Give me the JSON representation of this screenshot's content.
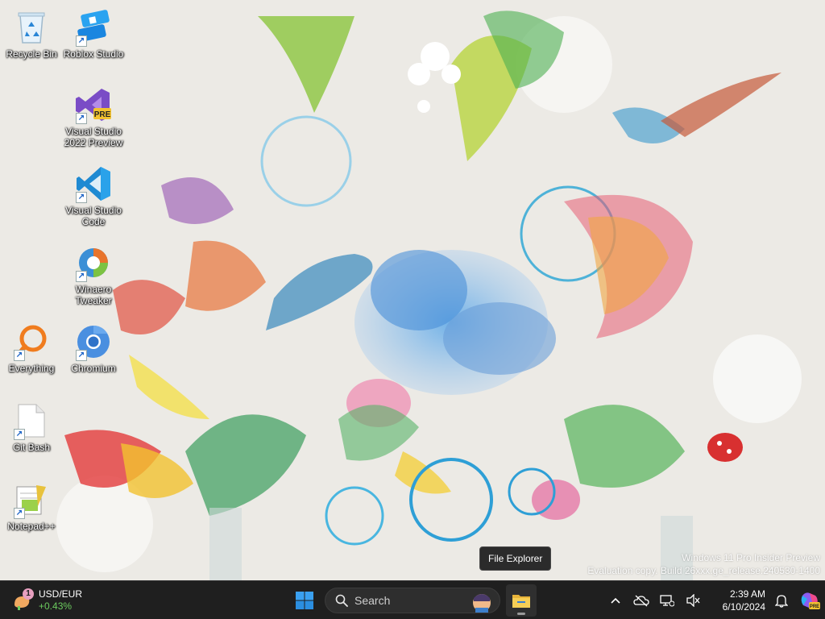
{
  "desktop": {
    "icons": [
      {
        "label": "Recycle Bin"
      },
      {
        "label": "Roblox Studio"
      },
      {
        "label": "Visual Studio 2022 Preview",
        "badge": "PRE"
      },
      {
        "label": "Visual Studio Code"
      },
      {
        "label": "Winaero Tweaker"
      },
      {
        "label": "Everything"
      },
      {
        "label": "Chromium"
      },
      {
        "label": "Git Bash"
      },
      {
        "label": "Notepad++"
      }
    ]
  },
  "watermark": {
    "line1": "Windows 11 Pro Insider Preview",
    "line2": "Evaluation copy. Build 26xxx.ge_release.240530-1400"
  },
  "tooltip": {
    "text": "File Explorer"
  },
  "taskbar": {
    "widget": {
      "badge": "1",
      "title": "USD/EUR",
      "change": "+0.43%",
      "change_color": "#6ccb5f"
    },
    "search": {
      "placeholder": "Search"
    },
    "pinned": [
      {
        "name": "File Explorer",
        "icon": "folder-icon"
      }
    ],
    "tray": {
      "time": "2:39 AM",
      "date": "6/10/2024"
    }
  },
  "colors": {
    "taskbar_bg": "#1f1f1f",
    "accent": "#0078d4"
  }
}
